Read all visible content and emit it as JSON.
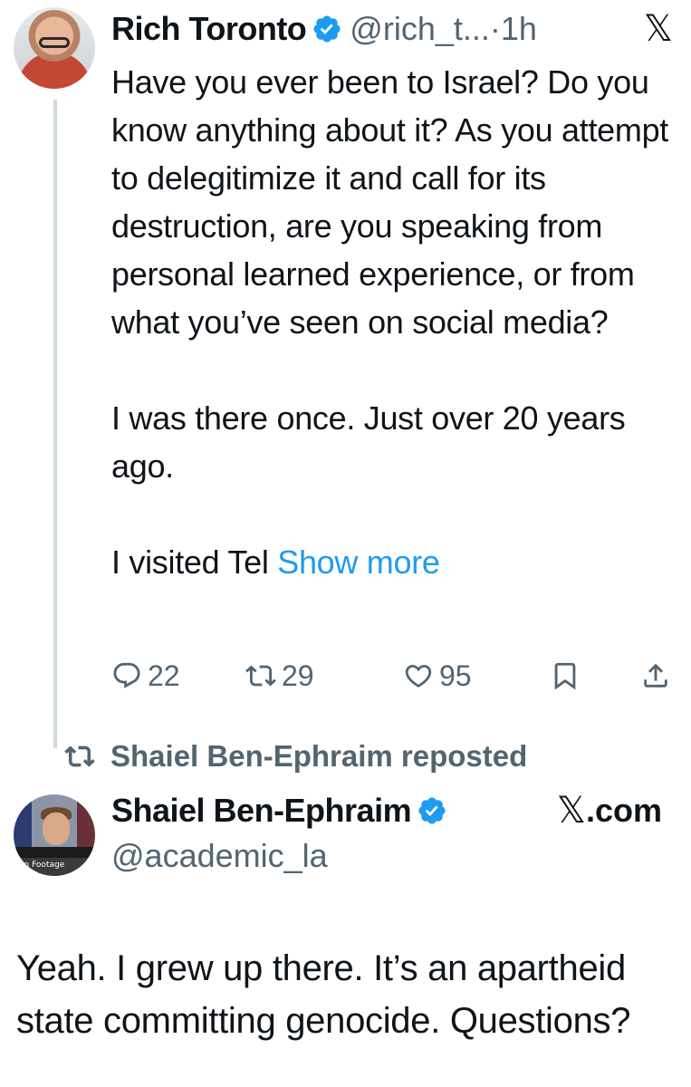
{
  "tweet": {
    "author_name": "Rich Toronto",
    "handle_time": "@rich_t...·1h",
    "brand_mark": "𝕏",
    "paragraphs": [
      "Have you ever been to Israel? Do you know anything about it? As you attempt to delegitimize it and call for its destruction, are you speaking from personal learned experience, or from what you’ve seen on social media?",
      "I was there once. Just over 20 years ago."
    ],
    "last_para_prefix": "I visited Tel",
    "show_more": "Show more",
    "stats": {
      "replies": "22",
      "reposts": "29",
      "likes": "95"
    }
  },
  "repost_header": {
    "text": "Shaiel Ben-Ephraim reposted"
  },
  "quoted_tweet": {
    "author_name": "Shaiel Ben-Ephraim",
    "handle": "@academic_la",
    "source_mark": "𝕏",
    "source_text": ".com",
    "avatar_caption": "on Footage",
    "body": "Yeah. I grew up there. It’s an apartheid state committing genocide. Questions?"
  },
  "colors": {
    "text": "#0f1419",
    "secondary": "#536471",
    "accent": "#1d9bf0",
    "thread_line": "#cfd9de"
  },
  "icons": [
    "verified-badge-icon",
    "x-logo-icon",
    "reply-icon",
    "repost-icon",
    "like-icon",
    "bookmark-icon",
    "share-icon"
  ]
}
